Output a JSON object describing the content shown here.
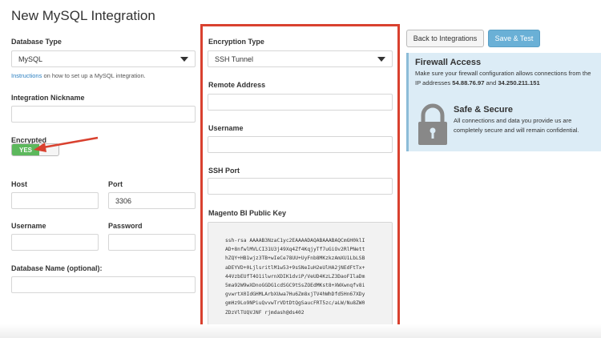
{
  "page": {
    "title": "New MySQL Integration"
  },
  "left": {
    "db_type": {
      "label": "Database Type",
      "value": "MySQL"
    },
    "instructions": {
      "link": "Instructions",
      "rest": " on how to set up a MySQL integration."
    },
    "nickname": {
      "label": "Integration Nickname",
      "value": ""
    },
    "encrypted": {
      "label": "Encrypted",
      "toggle": "YES"
    },
    "host": {
      "label": "Host",
      "value": ""
    },
    "port": {
      "label": "Port",
      "value": "3306"
    },
    "username": {
      "label": "Username",
      "value": ""
    },
    "password": {
      "label": "Password",
      "value": ""
    },
    "db_name": {
      "label": "Database Name (optional):",
      "value": ""
    }
  },
  "middle": {
    "encryption_type": {
      "label": "Encryption Type",
      "value": "SSH Tunnel"
    },
    "remote_address": {
      "label": "Remote Address",
      "value": ""
    },
    "username": {
      "label": "Username",
      "value": ""
    },
    "ssh_port": {
      "label": "SSH Port",
      "value": ""
    },
    "public_key": {
      "label": "Magento BI Public Key",
      "value": "ssh-rsa AAAAB3NzaC1yc2EAAAADAQABAAABAQCmGH0klI\nAD+8nfwlMVLCI31U3j49Xq4Zf4KqjyTf7uGiOv2RlPNett\nhZQY+HB1wjz3TB+wIeCe78UU+UyFnb8MKzkzAmXU1LbLSB\naDEYVD+0LjlsritlM1w53+9sSNeIuH2eUlHA2jNEdFtTx+\n44VzbEUfT4O1ilwrnXDIK1dviP/VeUD4KzLZ3DaoFIlaDm\n5ma92W9wXDnoGGDG1cdSGC9tSsZOEdMKst8+XWXwnqfv8i\ngvwrtX0IdGHMLArbXUwa7Hu6Zm8xjTV4hWhDfd5Hn67XDy\ngmHz9Lo9NPiuQvvwTrVDtDtQgSaucFRT5zc/aLW/Nu8ZW0\nZDzVlTUQVJNF rjmdash@ds402"
    }
  },
  "actions": {
    "back_label": "Back to Integrations",
    "save_label": "Save & Test"
  },
  "firewall": {
    "title": "Firewall Access",
    "text_before": "Make sure your firewall configuration allows connections from the IP addresses ",
    "ip1": "54.88.76.97",
    "and": " and ",
    "ip2": "34.250.211.151"
  },
  "secure": {
    "title": "Safe & Secure",
    "text": "All connections and data you provide us are completely secure and will remain confidential."
  },
  "colors": {
    "highlight": "#d9412f",
    "toggle_on": "#5cb85c",
    "link": "#2a7fc1",
    "primary_button": "#6ab0d6",
    "info_panel": "#dcecf6"
  }
}
